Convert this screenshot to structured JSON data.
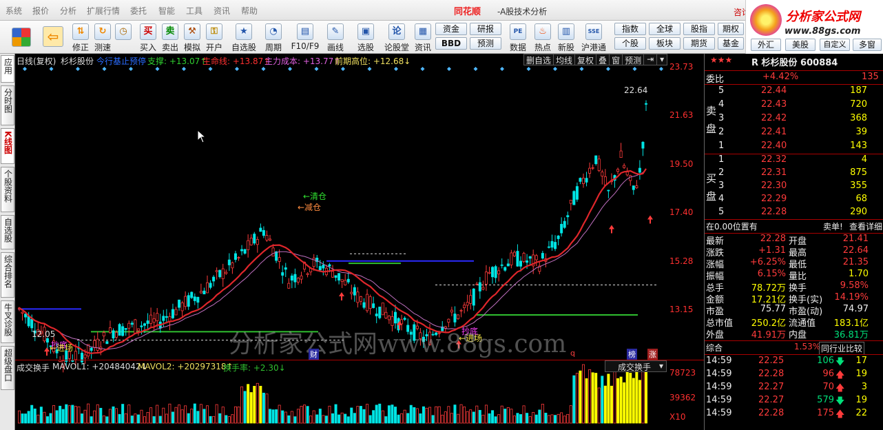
{
  "menu": [
    "系统",
    "报价",
    "分析",
    "扩展行情",
    "委托",
    "智能",
    "工具",
    "资讯",
    "帮助"
  ],
  "app_title": "同花顺",
  "window_title": "-A股技术分析",
  "consult": "咨询",
  "logo": {
    "line1": "分析家公式网",
    "line2": "www.88gs.com"
  },
  "toolbar": [
    "修正",
    "测速",
    "买入",
    "卖出",
    "模拟",
    "开户",
    "自选股",
    "周期",
    "F10/F9",
    "画线",
    "选股",
    "论股堂",
    "资讯",
    "数据",
    "热点",
    "新股",
    "沪港通"
  ],
  "toolbar_icons": {
    "buy": "买",
    "sell": "卖"
  },
  "side_buttons": [
    "资金",
    "研报",
    "BBD",
    "预测",
    "指数",
    "全球",
    "股指",
    "期权",
    "个股",
    "板块",
    "期货",
    "基金",
    "外汇",
    "美股",
    "自定义",
    "多窗"
  ],
  "left_tabs": [
    "应用",
    "分时图",
    "K线图",
    "个股资料",
    "自选股",
    "综合排名",
    "牛叉诊股",
    "超级盘口"
  ],
  "chart": {
    "header": {
      "mode": "日线(复权)",
      "name": "杉杉股份",
      "ind": "今行基止预停",
      "support": "支撑: +13.07↑",
      "life": "生命线: +13.87↑",
      "main_cost": "主力成本: +13.77↑",
      "prev_high": "前期高位: +12.68↓"
    },
    "buttons": [
      "删自选",
      "均线",
      "复权",
      "叠",
      "窗",
      "预测"
    ],
    "y_labels": [
      "23.73",
      "21.63",
      "19.50",
      "17.40",
      "15.28",
      "13.15"
    ],
    "annotations": {
      "qingcang": "←清仓",
      "jiancang": "←减仓",
      "price_high": "22.64",
      "price_low": "12.05",
      "chaodi": "抄底",
      "jinchang": "←进场",
      "chaodi2": "抄底",
      "jinchang2": "←进场"
    },
    "watermark": "分析家公式网www.88gs.com",
    "markers": {
      "cai": "财",
      "bang": "榜",
      "zhang": "涨",
      "q": "q"
    },
    "vol_header": {
      "name": "成交换手",
      "mavol1": "MAVOL1: +20484042↓",
      "mavol2": "MAVOL2: +20297318↑",
      "hs": "换手率: +2.30↓"
    },
    "vol_select": "成交换手",
    "vol_y": [
      "78723",
      "39362",
      "X10"
    ]
  },
  "quote": {
    "title": "R 杉杉股份 600884",
    "stars": "★★★",
    "weibi_label": "委比",
    "weibi": "+4.42%",
    "weibi_val": "135",
    "sell_label": "卖盘",
    "buy_label": "买盘",
    "asks": [
      {
        "l": "5",
        "p": "22.44",
        "v": "187"
      },
      {
        "l": "4",
        "p": "22.43",
        "v": "720"
      },
      {
        "l": "3",
        "p": "22.42",
        "v": "368"
      },
      {
        "l": "2",
        "p": "22.41",
        "v": "39"
      },
      {
        "l": "1",
        "p": "22.40",
        "v": "143"
      }
    ],
    "bids": [
      {
        "l": "1",
        "p": "22.32",
        "v": "4"
      },
      {
        "l": "2",
        "p": "22.31",
        "v": "875"
      },
      {
        "l": "3",
        "p": "22.30",
        "v": "355"
      },
      {
        "l": "4",
        "p": "22.29",
        "v": "68"
      },
      {
        "l": "5",
        "p": "22.28",
        "v": "290"
      }
    ],
    "pos": "在0.00位置有",
    "sell_single": "卖单!",
    "detail": "查看详细",
    "stats": [
      {
        "k": "最新",
        "v": "22.28",
        "k2": "开盘",
        "v2": "21.41"
      },
      {
        "k": "涨跌",
        "v": "+1.31",
        "k2": "最高",
        "v2": "22.64"
      },
      {
        "k": "涨幅",
        "v": "+6.25%",
        "k2": "最低",
        "v2": "21.35"
      },
      {
        "k": "振幅",
        "v": "6.15%",
        "k2": "量比",
        "v2": "1.70"
      },
      {
        "k": "总手",
        "v": "78.72万",
        "k2": "换手",
        "v2": "9.58%"
      },
      {
        "k": "金额",
        "v": "17.21亿",
        "k2": "换手(实)",
        "v2": "14.19%"
      },
      {
        "k": "市盈",
        "v": "75.77",
        "k2": "市盈(动)",
        "v2": "74.97"
      },
      {
        "k": "总市值",
        "v": "250.2亿",
        "k2": "流通值",
        "v2": "183.1亿"
      },
      {
        "k": "外盘",
        "v": "41.91万",
        "k2": "内盘",
        "v2": "36.81万"
      }
    ],
    "zonghe": "综合",
    "zonghe_val": "1.53%",
    "compare": "同行业比较",
    "ticks": [
      {
        "t": "14:59",
        "p": "22.25",
        "v": "106",
        "d": "down",
        "n": "17"
      },
      {
        "t": "14:59",
        "p": "22.28",
        "v": "96",
        "d": "up",
        "n": "19"
      },
      {
        "t": "14:59",
        "p": "22.27",
        "v": "70",
        "d": "up",
        "n": "3"
      },
      {
        "t": "14:59",
        "p": "22.27",
        "v": "579",
        "d": "down",
        "n": "19"
      },
      {
        "t": "14:59",
        "p": "22.28",
        "v": "175",
        "d": "up",
        "n": "22"
      }
    ]
  },
  "colors": {
    "up": "#ff3b3b",
    "down": "#00e5e5",
    "ma_red": "#e0262b",
    "ma_pink": "#c070c0",
    "support": "#2a2aff",
    "green": "#30c030"
  }
}
